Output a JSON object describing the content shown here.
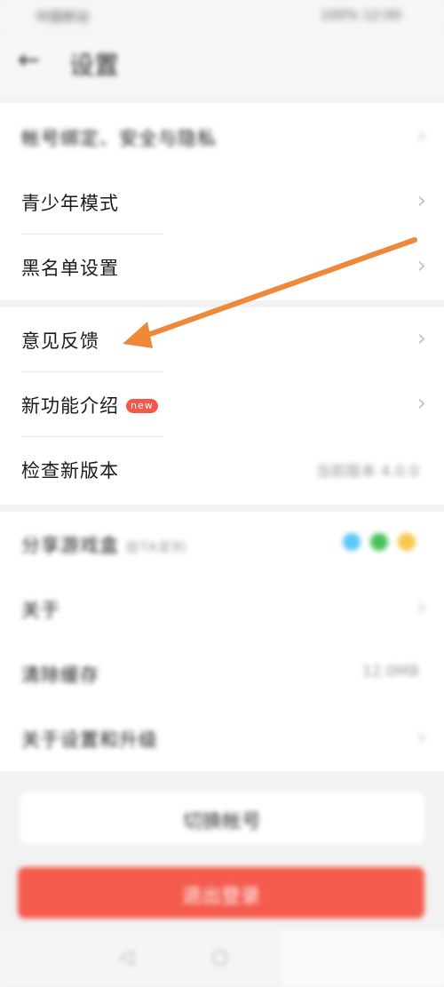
{
  "status_bar": {
    "left": "中国移动",
    "right": "100%  12:00"
  },
  "header": {
    "back": "←",
    "title": "设置"
  },
  "rows": {
    "account": "帐号绑定、安全与隐私",
    "teen_mode": "青少年模式",
    "blacklist": "黑名单设置",
    "feedback": "意见反馈",
    "new_features": "新功能介绍",
    "new_badge": "new",
    "check_update": "检查新版本",
    "check_update_value": "当前版本 4.0.0",
    "share": "分享游戏盒",
    "share_sub": "给TA安利",
    "about": "关于",
    "cache": "清除缓存",
    "cache_value": "12.0MB",
    "about_program": "关于设置和升级"
  },
  "buttons": {
    "switch_account": "切换帐号",
    "logout": "退出登录"
  },
  "nav": {
    "back": "◁",
    "home": "○"
  },
  "share_colors": [
    "#5bc8f5",
    "#49c25a",
    "#f6c94a"
  ],
  "accent_color": "#f45b4d",
  "arrow_color": "#f0883a"
}
